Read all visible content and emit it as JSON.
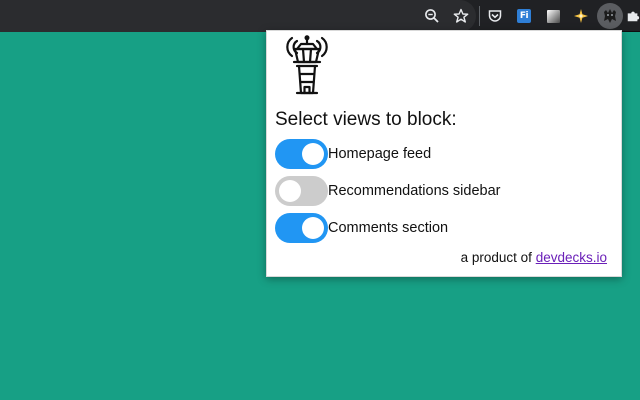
{
  "browser": {
    "toolbar_icons": [
      "zoom-icon",
      "bookmark-star-icon",
      "pocket-icon",
      "fi-extension-icon",
      "gray-square-extension-icon",
      "sparkle-extension-icon",
      "active-extension-icon",
      "puzzle-icon"
    ],
    "fi_extension_text": "Fi"
  },
  "popup": {
    "logo_icon": "control-tower-icon",
    "heading": "Select views to block:",
    "toggles": [
      {
        "label": "Homepage feed",
        "checked": true
      },
      {
        "label": "Recommendations sidebar",
        "checked": false
      },
      {
        "label": "Comments section",
        "checked": true
      }
    ],
    "footer_prefix": "a product of ",
    "footer_link": "devdecks.io"
  },
  "colors": {
    "page_background": "#17a085",
    "toggle_on": "#2196f3",
    "toggle_off": "#cccccc",
    "link": "#6a1fb8"
  }
}
